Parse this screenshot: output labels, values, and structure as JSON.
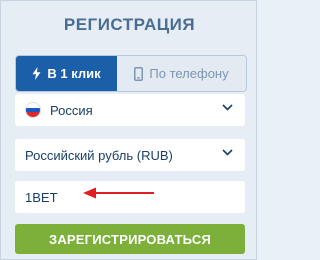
{
  "form": {
    "title": "РЕГИСТРАЦИЯ",
    "tabs": [
      {
        "label": "В 1 клик",
        "icon": "lightning-icon",
        "active": true
      },
      {
        "label": "По телефону",
        "icon": "phone-icon",
        "active": false
      }
    ],
    "country": {
      "value": "Россия",
      "icon": "russia-flag-icon"
    },
    "currency": {
      "value": "Российский рубль (RUB)"
    },
    "promo": {
      "value": "1BET"
    },
    "submit_label": "ЗАРЕГИСТРИРОВАТЬСЯ"
  },
  "colors": {
    "primary": "#1a5fa8",
    "accent_green": "#7cb03b",
    "arrow_red": "#e02020",
    "title": "#4a6d93"
  }
}
